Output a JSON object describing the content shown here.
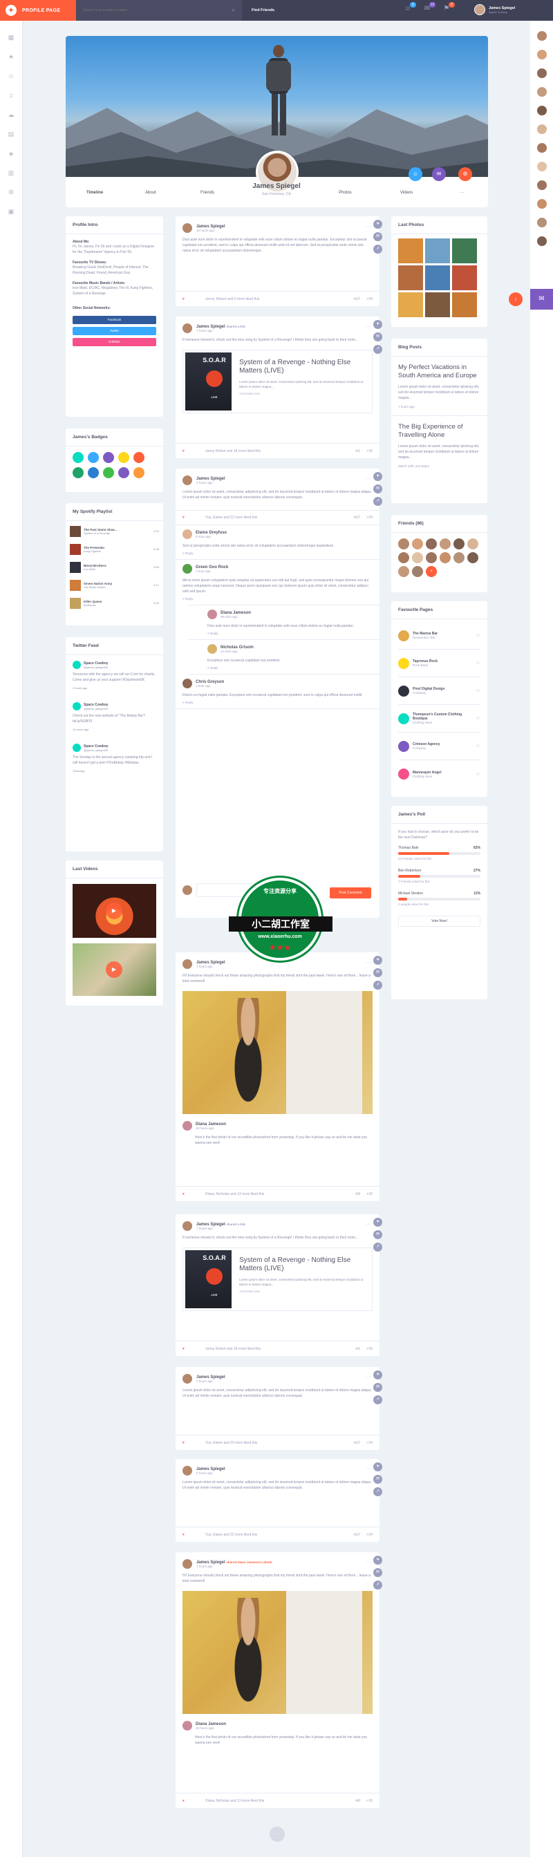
{
  "topbar": {
    "title": "PROFILE PAGE",
    "search_placeholder": "Search here people or pages...",
    "find_friends": "Find Friends",
    "badges": [
      "6",
      "12",
      "8"
    ],
    "user_name": "James Spiegel",
    "user_sub": "Space Cowboy"
  },
  "profile": {
    "name": "James Spiegel",
    "location": "San Francisco, CA",
    "nav": [
      "Timeline",
      "About",
      "Friends",
      "Photos",
      "Videos",
      "···"
    ]
  },
  "intro": {
    "title": "Profile Intro",
    "about_label": "About Me:",
    "about_text": "Hi, I'm James, I'm 36 and I work as a Digital Designer for the \"Daydreams\" Agency in Pier 56.",
    "tv_label": "Favourite TV Shows:",
    "tv_text": "Breaking Good, RedDevil, People of Interest, The Running Dead, Found, American Guy.",
    "music_label": "Favourite Music Bands / Artists:",
    "music_text": "Iron Maid, DC/AC, Megablow, The Ill, Kung Fighters, System of a Revenge.",
    "social_label": "Other Social Networks:",
    "social": [
      "Facebook",
      "Twitter",
      "Dribbble"
    ]
  },
  "badges": {
    "title": "James's Badges"
  },
  "playlist": {
    "title": "My Spotify Playlist",
    "items": [
      {
        "song": "The Past Starts Slow...",
        "artist": "System of a Revenge",
        "time": "3:22"
      },
      {
        "song": "The Pretender",
        "artist": "Kung Fighters",
        "time": "5:48"
      },
      {
        "song": "Blood Brothers",
        "artist": "Iron Maid",
        "time": "3:06"
      },
      {
        "song": "Seven Nation Army",
        "artist": "The Black Stripes",
        "time": "6:17"
      },
      {
        "song": "Killer Queen",
        "artist": "Archiduke",
        "time": "5:40"
      }
    ]
  },
  "twitter": {
    "title": "Twitter Feed",
    "items": [
      {
        "name": "Space Cowboy",
        "handle": "@james_spiegelOK",
        "text": "Tomorrow with the agency we will run 5 km for charity. Come and give us your support! #Daydream5K",
        "time": "2 hours ago"
      },
      {
        "name": "Space Cowboy",
        "handle": "@james_spiegelOK",
        "text": "Check out the new website of \"The Bebop Bar\"! bit.ly/9G8Ff3",
        "time": "16 hours ago"
      },
      {
        "name": "Space Cowboy",
        "handle": "@james_spiegelOK",
        "text": "The Sunday is the annual agency camping trip and I still haven't got a tent #TheBebop #Mofatac",
        "time": "Yesterday"
      }
    ]
  },
  "videos": {
    "title": "Last Videos"
  },
  "posts": {
    "p1": {
      "name": "James Spiegel",
      "time": "19 hours ago",
      "text": "Duis aute irure dolor in reprehenderit in voluptate velit esse cillum dolore eu fugiat nulla pariatur. Excepteur sint occaecat cupidatat non proident, sunt in culpa qui officia deserunt mollit anim id est laborum. Sed ut perspiciatis unde omnis iste natus error sit voluptatem accusantium doloremque.",
      "likes": "Jenny, Robert and 6 more liked this",
      "comments": "17",
      "shares": "24"
    },
    "p2": {
      "name": "James Spiegel",
      "shared": "shared a link",
      "time": "7 hours ago",
      "text": "If someone missed it, check out the new song by System of a Revenge! I thinks they are going back to their roots...",
      "link_title": "System of a Revenge - Nothing Else Matters (LIVE)",
      "link_desc": "Lorem ipsum dolor sit amet, consectetur ipisicing elit, sed do eiusmod tempor incididunt ut labore et dolore magna...",
      "link_url": "YOUTUBE.COM",
      "likes": "Jenny Robert and 18 more liked this",
      "comments": "1",
      "shares": "16"
    },
    "p3": {
      "name": "James Spiegel",
      "time": "2 hours ago",
      "text": "Lorem ipsum dolor sit amet, consectetur adipisicing elit, sed do eiusmod tempor incididunt ut labore et dolore magna aliqua. Ut enim ad minim veniam, quis nostrud exercitation ullamco laboris consequat.",
      "likes": "You, Elaine and 22 more liked this",
      "comments": "17",
      "shares": "24"
    },
    "comments": [
      {
        "name": "Elaine Dreyfuss",
        "time": "5 mins ago",
        "text": "Sed ut perspiciatis unde omnis iste natus error sit voluptatem accusantium doloremque laudantium."
      },
      {
        "name": "Green Goo Rock",
        "time": "1 hour ago",
        "text": "Mirna more ipsum voluptatem quia voluptas sit aspernatur aut odit aut fugit, sed quia consequuntur magni dolores eos qui ratione voluptatem sequi nesciunt. Neque porro quisquam est, qui dolorem ipsum quia dolor sit amet, consectetur adipisci velit sed ipsum."
      },
      {
        "name": "Diana Jameson",
        "time": "39 mins ago",
        "text": "Duis aute irure dolor in reprehenderit in voluptate velit esse cillum dolore eu fugiat nulla pariatur."
      },
      {
        "name": "Nicholas Grisom",
        "time": "24 mins ago",
        "text": "Excepteur sint occaecat cupidatat non proident."
      },
      {
        "name": "Chris Greyson",
        "time": "1 hour ago",
        "text": "Dolore eu fugiat nulla pariatur. Excepteur sint occaecat cupidatat non proident, sunt in culpa qui officia deserunt mollit."
      }
    ],
    "reply": "Reply",
    "post_comment": "Post Comment",
    "p4": {
      "name": "James Spiegel",
      "time": "7 hours ago",
      "text": "Hi! Everyone should check out these amazing photographs that my friend shot the past week. Here's one of them... leave a kind comment!",
      "c_name": "Diana Jameson",
      "c_time": "16 hours ago",
      "c_text": "Here's the first photo of our incredible photoshoot from yesterday. If you like it please say so and tel me what you wanna see next!",
      "likes": "Diana, Nicholas and 13 more liked this",
      "comments": "0",
      "shares": "16"
    },
    "p5": {
      "name": "James Spiegel",
      "shared": "shared a link",
      "time": "7 hours ago",
      "text": "If someone missed it, check out the new song by System of a Revenge! I thinks they are going back to their roots...",
      "link_title": "System of a Revenge - Nothing Else Matters (LIVE)",
      "link_desc": "Lorem ipsum dolor sit amet, consectetur ipisicing elit, sed do eiusmod tempor incididunt ut labore et dolore magna...",
      "link_url": "YOUTUBE.COM",
      "likes": "Jenny Robert and 18 more liked this",
      "comments": "1",
      "shares": "16"
    },
    "p6": {
      "name": "James Spiegel",
      "time": "2 hours ago",
      "text": "Lorem ipsum dolor sit amet, consectetur adipisicing elit, sed do eiusmod tempor incididunt ut labore et dolore magna aliqua. Ut enim ad minim veniam, quis nostrud exercitation ullamco laboris consequat.",
      "likes": "You, Elaine and 22 more liked this",
      "comments": "17",
      "shares": "24"
    },
    "p7": {
      "name": "James Spiegel",
      "time": "2 hours ago",
      "text": "Lorem ipsum dolor sit amet, consectetur adipisicing elit, sed do eiusmod tempor incididunt ut labore et dolore magna aliqua. Ut enim ad minim veniam, quis nostrud exercitation ullamco laboris consequat.",
      "likes": "You, Elaine and 22 more liked this",
      "comments": "17",
      "shares": "24"
    },
    "p8": {
      "name": "James Spiegel",
      "shared": "shared Diana Jameson's photo",
      "time": "7 hours ago",
      "text": "Hi! Everyone should check out these amazing photographs that my friend shot the past week. Here's one of them... leave a kind comment!",
      "c_name": "Diana Jameson",
      "c_time": "16 hours ago",
      "c_text": "Here's the first photo of our incredible photoshoot from yesterday. If you like it please say so and tel me what you wanna see next!",
      "likes": "Diana, Nicholas and 13 more liked this",
      "comments": "0",
      "shares": "16"
    }
  },
  "right": {
    "photos_title": "Last Photos",
    "blog_title": "Blog Posts",
    "blog": [
      {
        "title": "My Perfect Vacations in South America and Europe",
        "text": "Lorem ipsum dolor sit amet, consectetur ipisicing elit, sed do eiusmod tempor incididunt ut labore et dolore magna...",
        "time": "7 hours ago"
      },
      {
        "title": "The Big Experience of Travelling Alone",
        "text": "Lorem ipsum dolor sit amet, consectetur ipisicing elit, sed do eiusmod tempor incididunt ut labore et dolore magna...",
        "time": "March 18th, at 6:52pm"
      }
    ],
    "friends_title": "Friends (86)",
    "pages_title": "Favourite Pages",
    "pages": [
      {
        "name": "The Marina Bar",
        "cat": "Restaurant / Bar"
      },
      {
        "name": "Tapronus Rock",
        "cat": "Rock Band"
      },
      {
        "name": "Pixel Digital Design",
        "cat": "Company"
      },
      {
        "name": "Thompson's Custom Clothing Boutique",
        "cat": "Clothing Store"
      },
      {
        "name": "Crimson Agency",
        "cat": "Company"
      },
      {
        "name": "Mannequin Angel",
        "cat": "Clothing Store"
      }
    ],
    "poll_title": "James's Poll",
    "poll_q": "If you had to choose, which actor do you prefer to be the next Darkman?",
    "poll": [
      {
        "name": "Thomas Bale",
        "pct": "62%",
        "voted": "12 Friends voted for this",
        "value": 62
      },
      {
        "name": "Ben Robertson",
        "pct": "27%",
        "voted": "7 Friends voted for this",
        "value": 27
      },
      {
        "name": "Michael Streiton",
        "pct": "11%",
        "voted": "2 people voted for this",
        "value": 11
      }
    ],
    "vote": "Vote Now!"
  },
  "watermark": {
    "top": "专注资源分享",
    "band": "小二胡工作室",
    "url": "www.xiaoerhu.com"
  },
  "colors": {
    "accent": "#ff5e3a",
    "dark": "#3f4257",
    "purple": "#7c5ac2",
    "blue": "#38a9ff",
    "green": "#08ddc1",
    "yellow": "#ffd71b"
  }
}
